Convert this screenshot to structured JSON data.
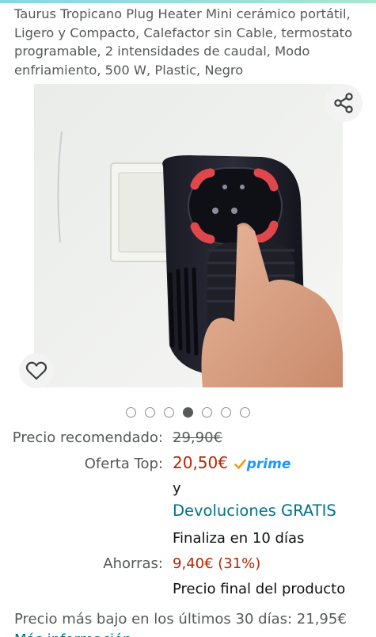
{
  "product": {
    "title": "Taurus Tropicano Plug Heater Mini cerámico portátil, Ligero y Compacto, Calefactor sin Cable, termostato programable, 2 intensidades de caudal, Modo enfriamiento, 500 W, Plastic, Negro"
  },
  "gallery": {
    "image_count": 7,
    "active_index": 3,
    "share_icon": "share-icon",
    "wishlist_icon": "heart-icon"
  },
  "pricing": {
    "list_label": "Precio recomendado:",
    "list_price": "29,90€",
    "deal_label": "Oferta Top:",
    "deal_price": "20,50€",
    "prime_text": "prime",
    "and_text": "y",
    "returns_text": "Devoluciones GRATIS",
    "ends_text": "Finaliza en 10 días",
    "savings_label": "Ahorras:",
    "savings_value": "9,40€ (31%)",
    "final_price_note": "Precio final del producto",
    "lowest_30_days": "Precio más bajo en los últimos 30 días: 21,95€",
    "more_info": "Más información"
  },
  "colors": {
    "price_red": "#b12704",
    "link_teal": "#007185",
    "prime_blue": "#1a98ff"
  }
}
